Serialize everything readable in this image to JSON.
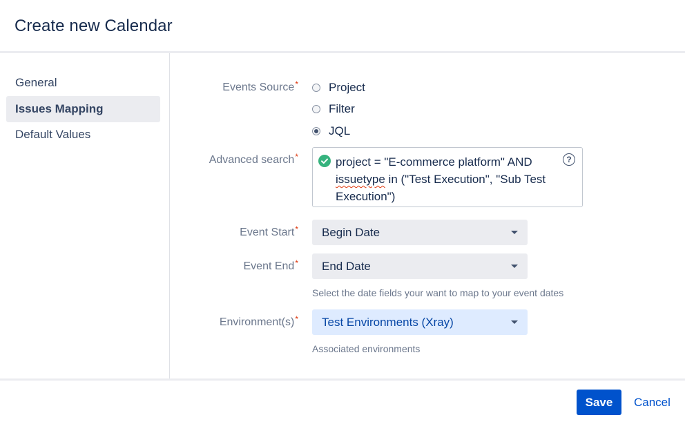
{
  "dialog": {
    "title": "Create new Calendar"
  },
  "sidebar": {
    "items": [
      {
        "label": "General",
        "active": false
      },
      {
        "label": "Issues Mapping",
        "active": true
      },
      {
        "label": "Default Values",
        "active": false
      }
    ]
  },
  "form": {
    "required_marker": "*",
    "events_source": {
      "label": "Events Source",
      "options": [
        {
          "label": "Project",
          "checked": false
        },
        {
          "label": "Filter",
          "checked": false
        },
        {
          "label": "JQL",
          "checked": true
        }
      ]
    },
    "advanced_search": {
      "label": "Advanced search",
      "query_part1": "project = \"E-commerce platform\" AND",
      "query_keyword": "issuetype",
      "query_part2": " in (\"Test Execution\", \"Sub Test Execution\")",
      "valid": true,
      "help_glyph": "?"
    },
    "event_start": {
      "label": "Event Start",
      "value": "Begin Date"
    },
    "event_end": {
      "label": "Event End",
      "value": "End Date",
      "help": "Select the date fields your want to map to your event dates"
    },
    "environments": {
      "label": "Environment(s)",
      "value": "Test Environments (Xray)",
      "help": "Associated environments"
    }
  },
  "footer": {
    "save_label": "Save",
    "cancel_label": "Cancel"
  },
  "colors": {
    "primary": "#0052cc",
    "required": "#de350b",
    "valid": "#36b37e",
    "selected_bg": "#deebff",
    "select_bg": "#ebecf0"
  }
}
